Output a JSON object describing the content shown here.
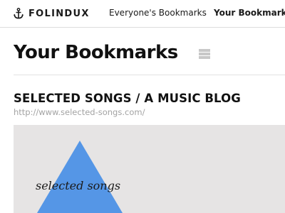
{
  "nav": {
    "brand": "FOLINDUX",
    "brand_icon": "anchor-icon",
    "links": [
      {
        "label": "Everyone's Bookmarks",
        "active": false
      },
      {
        "label": "Your Bookmarks",
        "active": true
      }
    ]
  },
  "page": {
    "title": "Your Bookmarks",
    "view_toggle_icon": "list-view-icon"
  },
  "bookmarks": [
    {
      "title": "SELECTED SONGS / A MUSIC BLOG",
      "url": "http://www.selected-songs.com/",
      "preview": {
        "text": "selected songs",
        "background_color": "#e6e4e4",
        "triangle_color": "#5596e6"
      }
    }
  ],
  "colors": {
    "text": "#1a1a1a",
    "url": "#a3a3a3",
    "divider": "#dcdcdc",
    "toggle": "#c8c8c8"
  }
}
